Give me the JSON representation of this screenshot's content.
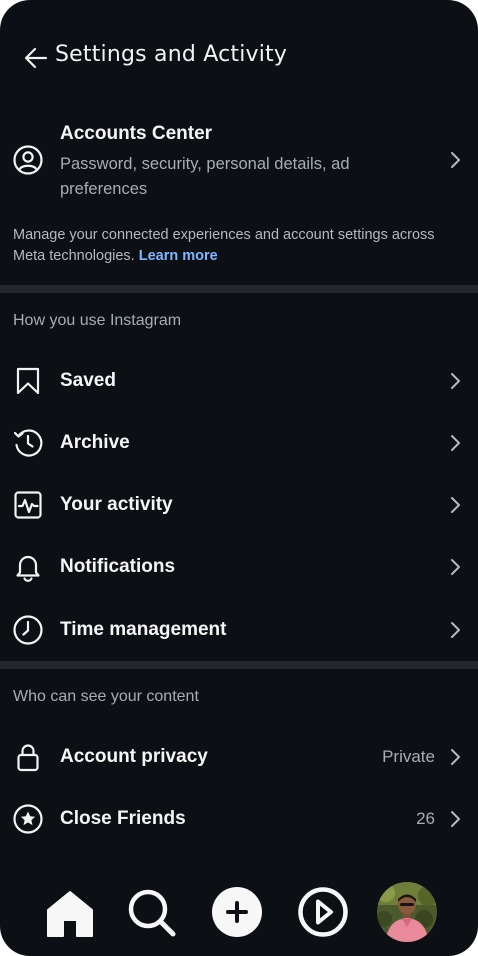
{
  "header": {
    "title": "Settings and Activity",
    "back_icon": "arrow-left-icon"
  },
  "accounts_center": {
    "title": "Accounts Center",
    "description": "Password, security, personal details, ad preferences",
    "icon": "user-circle-icon"
  },
  "meta_note": {
    "text": "Manage your connected experiences and account settings across Meta technologies.",
    "link": "Learn more"
  },
  "section_how": {
    "heading": "How you use Instagram",
    "items": [
      {
        "label": "Saved",
        "icon": "bookmark-icon"
      },
      {
        "label": "Archive",
        "icon": "archive-history-icon"
      },
      {
        "label": "Your activity",
        "icon": "activity-icon"
      },
      {
        "label": "Notifications",
        "icon": "bell-icon"
      },
      {
        "label": "Time management",
        "icon": "clock-icon"
      }
    ]
  },
  "section_who": {
    "heading": "Who can see your content",
    "items": [
      {
        "label": "Account privacy",
        "value": "Private",
        "icon": "lock-icon"
      },
      {
        "label": "Close Friends",
        "value": "26",
        "icon": "star-circle-icon"
      }
    ]
  },
  "bottom_nav": [
    "home-icon",
    "search-icon",
    "create-plus-icon",
    "reels-play-icon",
    "profile-avatar"
  ],
  "colors": {
    "background": "#0c0f14",
    "text": "#f5f5f5",
    "secondary_text": "#a8adb5",
    "link": "#7eb6ff",
    "divider": "#23262b"
  }
}
